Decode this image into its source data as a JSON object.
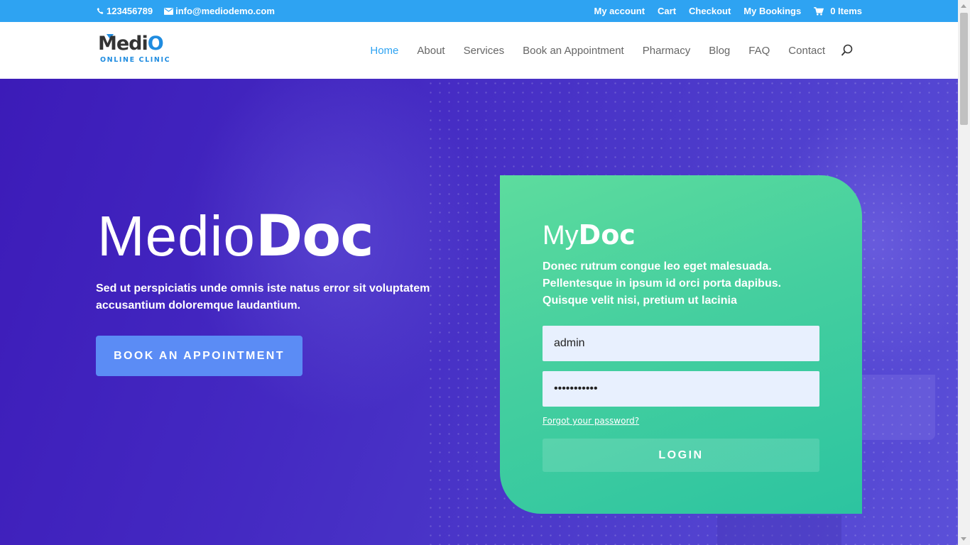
{
  "topbar": {
    "phone": "123456789",
    "email": "info@mediodemo.com",
    "links": [
      "My account",
      "Cart",
      "Checkout",
      "My Bookings"
    ],
    "cart_label": "0 Items",
    "bg_color": "#2ea3f2"
  },
  "logo": {
    "word_start": "Medi",
    "word_end": "O",
    "tagline": "ONLINE CLINIC"
  },
  "nav": {
    "items": [
      "Home",
      "About",
      "Services",
      "Book an Appointment",
      "Pharmacy",
      "Blog",
      "FAQ",
      "Contact"
    ],
    "active": "Home",
    "search_icon": "search-icon"
  },
  "hero": {
    "title_light": "Medio",
    "title_bold": "Doc",
    "subtitle": "Sed ut perspiciatis unde omnis iste natus error sit voluptatem accusantium doloremque laudantium.",
    "button_label": "BOOK AN APPOINTMENT",
    "button_color": "#5b8cf5"
  },
  "login": {
    "title_light": "My",
    "title_bold": "Doc",
    "description": "Donec rutrum congue leo eget malesuada. Pellentesque in ipsum id orci porta dapibus. Quisque velit nisi, pretium ut lacinia",
    "username_value": "admin",
    "password_value": "•••••••••••",
    "forgot_label": "Forgot your password?",
    "button_label": "LOGIN",
    "card_color": "#45cf9f"
  }
}
